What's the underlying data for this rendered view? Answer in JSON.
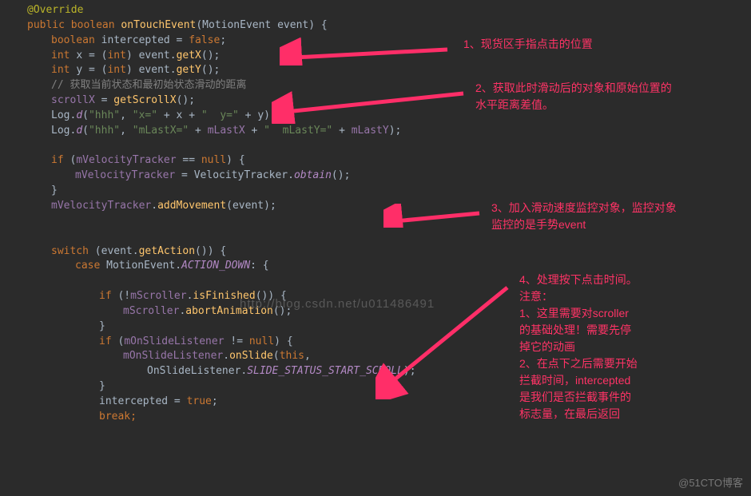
{
  "code": {
    "l1": "@Override",
    "l2a": "public ",
    "l2b": "boolean ",
    "l2c": "onTouchEvent",
    "l2d": "(MotionEvent event) {",
    "l3a": "boolean ",
    "l3b": "intercepted",
    "l3c": " = ",
    "l3d": "false",
    "l3e": ";",
    "l4a": "int ",
    "l4b": "x = (",
    "l4c": "int",
    "l4d": ") event.",
    "l4e": "getX",
    "l4f": "();",
    "l5a": "int ",
    "l5b": "y = (",
    "l5c": "int",
    "l5d": ") event.",
    "l5e": "getY",
    "l5f": "();",
    "l6": "// 获取当前状态和最初始状态滑动的距离",
    "l7a": "scrollX",
    "l7b": " = ",
    "l7c": "getScrollX",
    "l7d": "();",
    "l8a": "Log.",
    "l8b": "d",
    "l8c": "(",
    "l8d": "\"hhh\"",
    "l8e": ", ",
    "l8f": "\"x=\"",
    "l8g": " + x + ",
    "l8h": "\"  y=\"",
    "l8i": " + y);",
    "l9a": "Log.",
    "l9b": "d",
    "l9c": "(",
    "l9d": "\"hhh\"",
    "l9e": ", ",
    "l9f": "\"mLastX=\"",
    "l9g": " + ",
    "l9h": "mLastX",
    "l9i": " + ",
    "l9j": "\"  mLastY=\"",
    "l9k": " + ",
    "l9l": "mLastY",
    "l9m": ");",
    "l11a": "if ",
    "l11b": "(",
    "l11c": "mVelocityTracker",
    "l11d": " == ",
    "l11e": "null",
    "l11f": ") {",
    "l12a": "mVelocityTracker",
    "l12b": " = VelocityTracker.",
    "l12c": "obtain",
    "l12d": "();",
    "l13": "}",
    "l14a": "mVelocityTracker",
    "l14b": ".",
    "l14c": "addMovement",
    "l14d": "(event);",
    "l16a": "switch ",
    "l16b": "(event.",
    "l16c": "getAction",
    "l16d": "()) {",
    "l17a": "case ",
    "l17b": "MotionEvent.",
    "l17c": "ACTION_DOWN",
    "l17d": ": {",
    "l19a": "if ",
    "l19b": "(!",
    "l19c": "mScroller",
    "l19d": ".",
    "l19e": "isFinished",
    "l19f": "()) {",
    "l20a": "mScroller",
    "l20b": ".",
    "l20c": "abortAnimation",
    "l20d": "();",
    "l21": "}",
    "l22a": "if ",
    "l22b": "(",
    "l22c": "mOnSlideListener",
    "l22d": " != ",
    "l22e": "null",
    "l22f": ") {",
    "l23a": "mOnSlideListener",
    "l23b": ".",
    "l23c": "onSlide",
    "l23d": "(",
    "l23e": "this",
    "l23f": ",",
    "l24a": "OnSlideListener.",
    "l24b": "SLIDE_STATUS_START_SCROLL",
    "l24c": ");",
    "l25": "}",
    "l26a": "intercepted",
    "l26b": " = ",
    "l26c": "true",
    "l26d": ";",
    "l27": "break;"
  },
  "notes": {
    "n1": "1、现货区手指点击的位置",
    "n2": "2、获取此时滑动后的对象和原始位置的\n水平距离差值。",
    "n3": "3、加入滑动速度监控对象，监控对象\n监控的是手势event",
    "n4": "4、处理按下点击时间。\n注意：\n1、这里需要对scroller\n的基础处理！需要先停\n掉它的动画\n2、在点下之后需要开始\n拦截时间，intercepted\n是我们是否拦截事件的\n标志量，在最后返回"
  },
  "watermarks": {
    "center": "http://blog.csdn.net/u011486491",
    "corner": "@51CTO博客"
  },
  "colors": {
    "bg": "#2b2b2b",
    "note": "#ff3366",
    "arrow": "#ff2e68"
  }
}
